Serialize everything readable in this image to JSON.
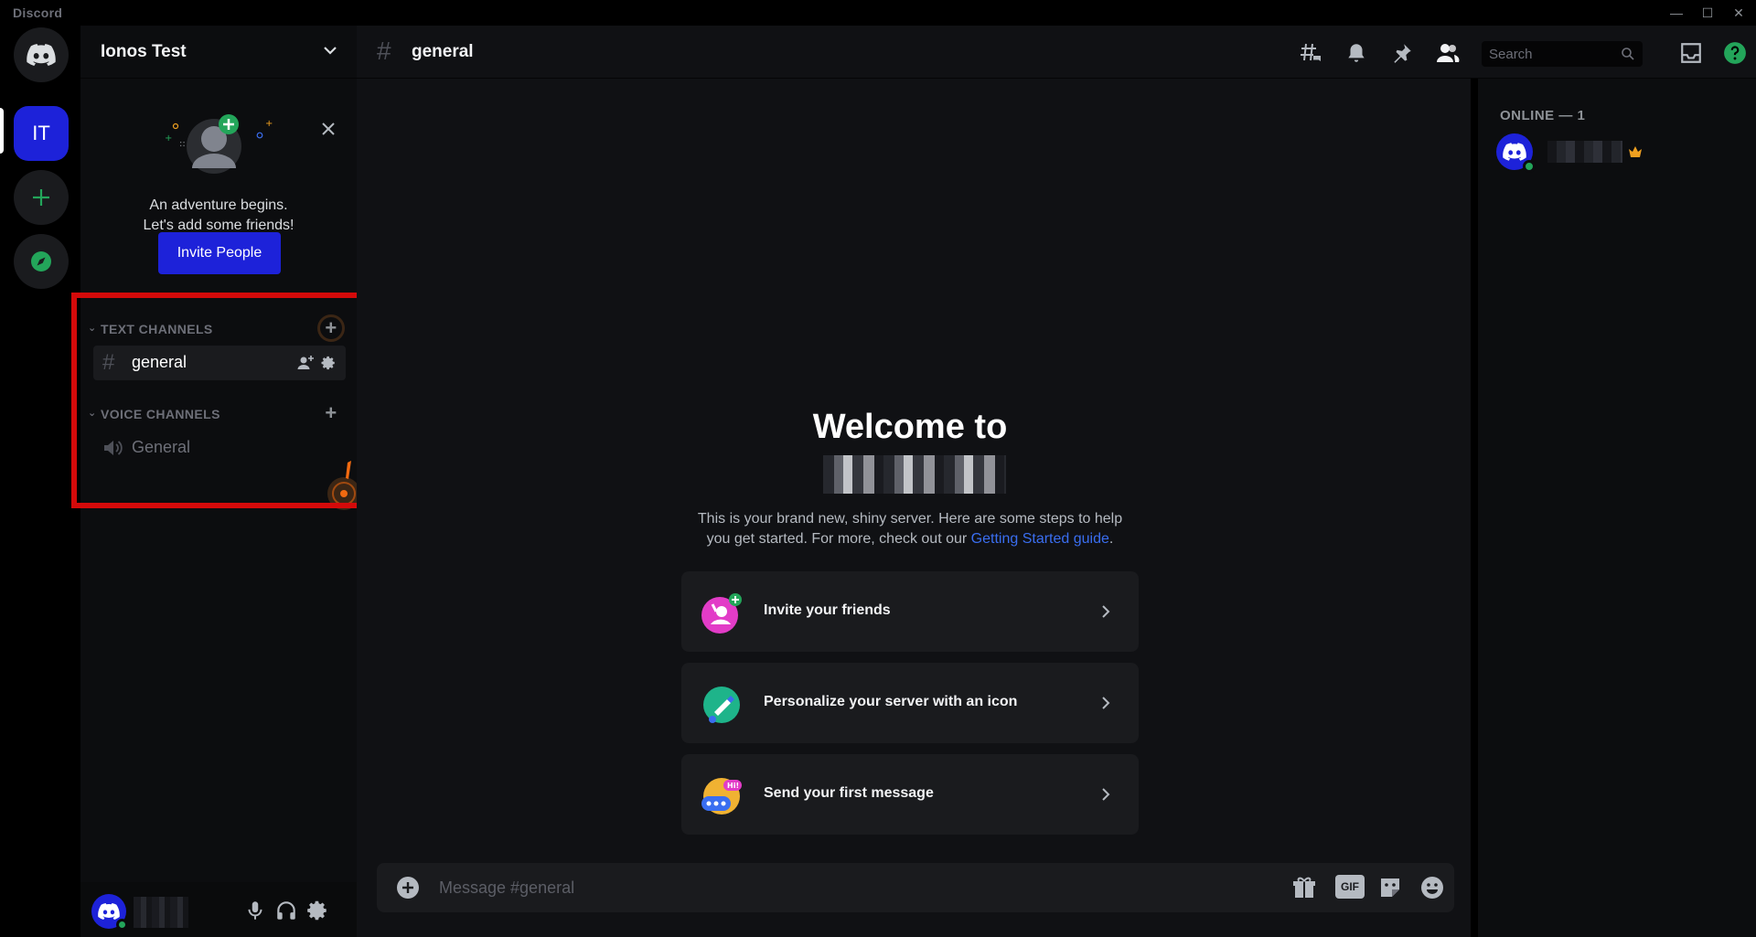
{
  "titlebar": {
    "app_name": "Discord",
    "minimize": "—",
    "maximize": "☐",
    "close": "✕"
  },
  "rail": {
    "active_server_initials": "IT",
    "active_server_name": "Ionos Test"
  },
  "sidebar": {
    "server_name": "Ionos Test",
    "invite_card": {
      "line1": "An adventure begins.",
      "line2": "Let's add some friends!",
      "button": "Invite People"
    },
    "categories": [
      {
        "label": "TEXT CHANNELS",
        "caret": "⌄",
        "add": "+"
      },
      {
        "label": "VOICE CHANNELS",
        "caret": "⌄",
        "add": "+"
      }
    ],
    "text_channels": [
      {
        "name": "general",
        "symbol": "#",
        "selected": true
      }
    ],
    "voice_channels": [
      {
        "name": "General"
      }
    ]
  },
  "chat": {
    "channel_symbol": "#",
    "channel_name": "general",
    "search_placeholder": "Search",
    "welcome_title": "Welcome to",
    "welcome_line1": "This is your brand new, shiny server. Here are some steps to help",
    "welcome_line2_prefix": "you get started. For more, check out our ",
    "welcome_link": "Getting Started guide",
    "welcome_line2_suffix": ".",
    "steps": [
      {
        "label": "Invite your friends",
        "icon": "invite-friends-icon"
      },
      {
        "label": "Personalize your server with an icon",
        "icon": "personalize-icon"
      },
      {
        "label": "Send your first message",
        "icon": "first-message-icon"
      }
    ],
    "composer_placeholder": "Message #general",
    "composer_icons": [
      "gift-icon",
      "gif-icon",
      "sticker-icon",
      "emoji-icon"
    ],
    "gif_label": "GIF"
  },
  "members": {
    "header": "ONLINE — 1"
  },
  "colors": {
    "accent": "#1d22d9",
    "highlight_box": "#d40a0a",
    "online": "#23a55a",
    "owner_crown": "#f0a020",
    "link": "#3a6ef0"
  }
}
